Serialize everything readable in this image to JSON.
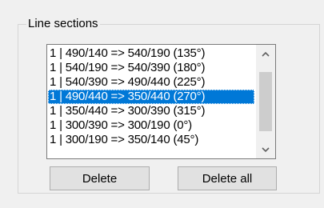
{
  "group": {
    "title": "Line sections"
  },
  "list": {
    "items": [
      "1 | 490/140 => 540/190 (135°)",
      "1 | 540/190 => 540/390 (180°)",
      "1 | 540/390 => 490/440 (225°)",
      "1 | 490/440 => 350/440 (270°)",
      "1 | 350/440 => 300/390 (315°)",
      "1 | 300/390 => 300/190 (0°)",
      "1 | 300/190 => 350/140 (45°)"
    ],
    "selected_index": 3
  },
  "scrollbar": {
    "up_icon": "chevron-up-icon",
    "down_icon": "chevron-down-icon"
  },
  "buttons": {
    "delete_label": "Delete",
    "delete_all_label": "Delete all"
  },
  "colors": {
    "selection": "#0078d7",
    "selection_text": "#ffffff"
  }
}
